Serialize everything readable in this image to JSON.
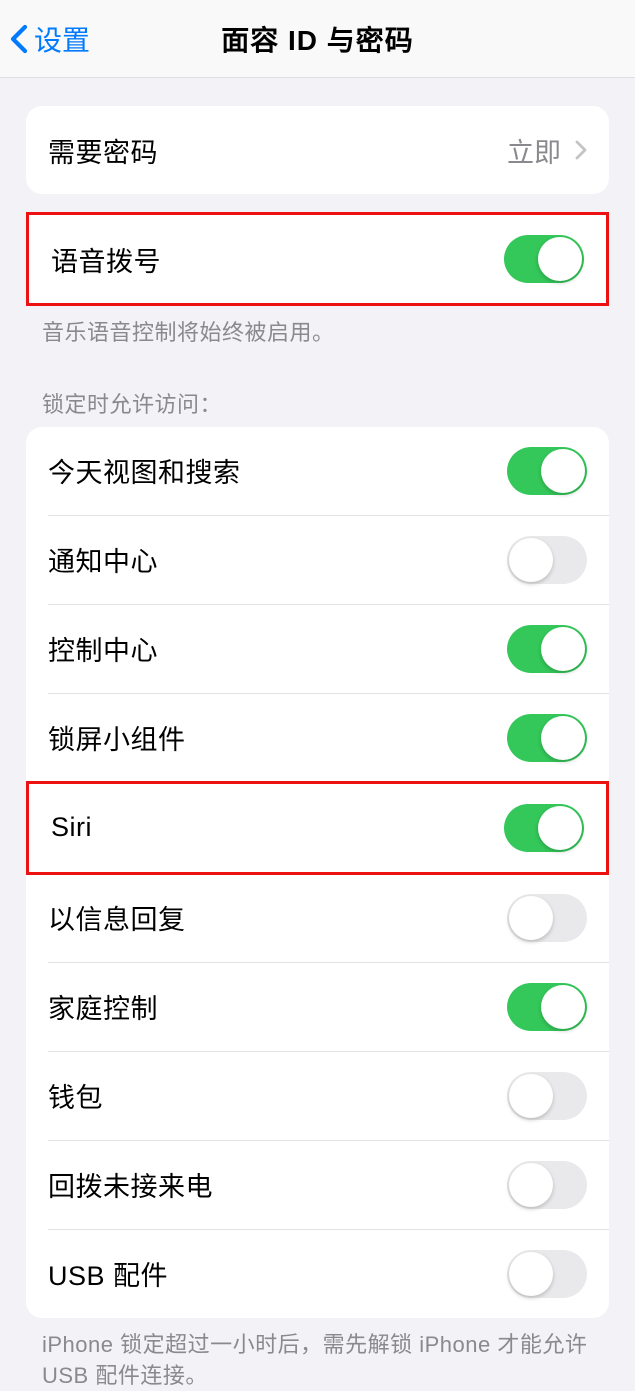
{
  "header": {
    "back_label": "设置",
    "title": "面容 ID 与密码"
  },
  "require_passcode": {
    "label": "需要密码",
    "value": "立即"
  },
  "voice_dial": {
    "label": "语音拨号",
    "enabled": true,
    "footer": "音乐语音控制将始终被启用。"
  },
  "lock_access": {
    "header": "锁定时允许访问：",
    "items": [
      {
        "label": "今天视图和搜索",
        "enabled": true
      },
      {
        "label": "通知中心",
        "enabled": false
      },
      {
        "label": "控制中心",
        "enabled": true
      },
      {
        "label": "锁屏小组件",
        "enabled": true
      },
      {
        "label": "Siri",
        "enabled": true,
        "highlight": true
      },
      {
        "label": "以信息回复",
        "enabled": false
      },
      {
        "label": "家庭控制",
        "enabled": true
      },
      {
        "label": "钱包",
        "enabled": false
      },
      {
        "label": "回拨未接来电",
        "enabled": false
      },
      {
        "label": "USB 配件",
        "enabled": false
      }
    ],
    "footer": "iPhone 锁定超过一小时后，需先解锁 iPhone 才能允许USB 配件连接。"
  }
}
